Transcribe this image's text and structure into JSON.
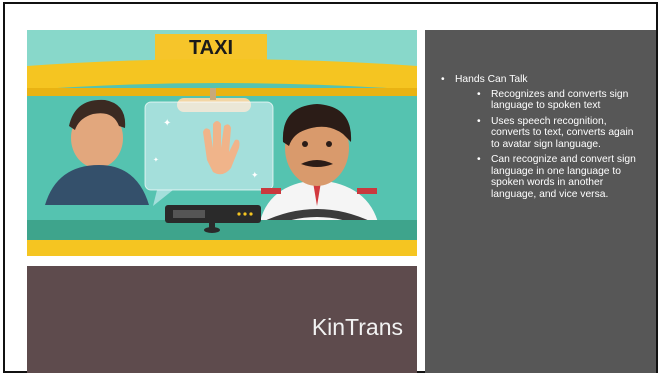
{
  "slide": {
    "title": "KinTrans",
    "illustration": {
      "sign_text": "TAXI"
    },
    "bullets": [
      {
        "text": "Hands Can Talk",
        "sub": [
          "Recognizes and converts sign language to spoken text",
          "Uses speech recognition, converts to text, converts again to avatar sign language.",
          "Can recognize and convert sign language in one language to spoken words in another language, and vice versa."
        ]
      }
    ]
  },
  "colors": {
    "title_panel": "#5e4b4d",
    "bullet_panel": "#575757",
    "taxi_yellow": "#f5c521",
    "cab_teal": "#3cb6a3"
  }
}
